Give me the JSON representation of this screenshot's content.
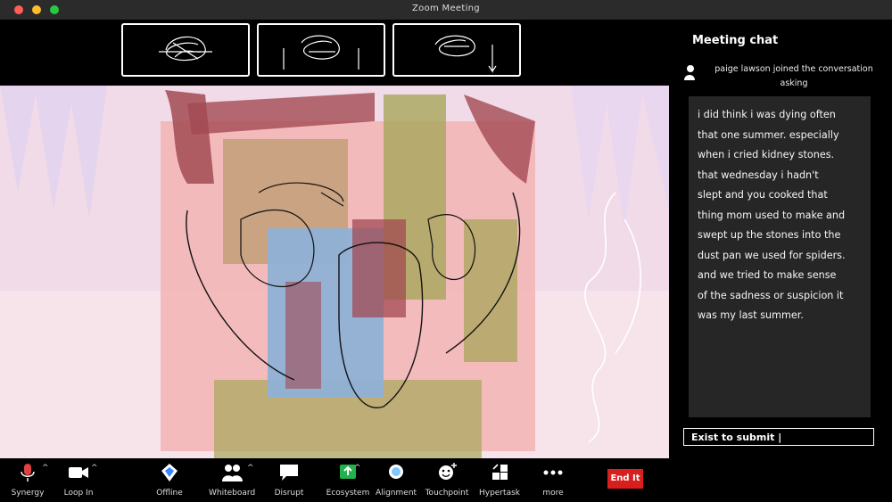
{
  "window": {
    "title": "Zoom Meeting"
  },
  "chat": {
    "title": "Meeting chat",
    "join_notice": "paige lawson   joined the conversation\nasking",
    "message": "i did think i was dying often\nthat one summer. especially\nwhen i cried kidney stones.\nthat wednesday i hadn't\nslept and you cooked that\nthing mom used to make and\nswept up the stones into the\ndust pan we used for spiders.\nand we tried to make sense\nof the sadness or suspicion it\nwas my last summer.",
    "input_value": "Exist to submit |"
  },
  "toolbar": {
    "items": [
      {
        "label": "Synergy",
        "icon": "microphone-icon"
      },
      {
        "label": "Loop In",
        "icon": "video-camera-icon"
      },
      {
        "label": "Offline",
        "icon": "shield-icon"
      },
      {
        "label": "Whiteboard",
        "icon": "participants-icon"
      },
      {
        "label": "Disrupt",
        "icon": "chat-bubble-icon"
      },
      {
        "label": "Ecosystem",
        "icon": "share-screen-icon"
      },
      {
        "label": "Alignment",
        "icon": "record-icon"
      },
      {
        "label": "Touchpoint",
        "icon": "reactions-icon"
      },
      {
        "label": "Hypertask",
        "icon": "apps-icon"
      },
      {
        "label": "more",
        "icon": "more-dots-icon"
      }
    ],
    "end_label": "End It"
  },
  "colors": {
    "end_button": "#d91e1e",
    "share_icon": "#22b14c",
    "mic_icon": "#e04040"
  }
}
